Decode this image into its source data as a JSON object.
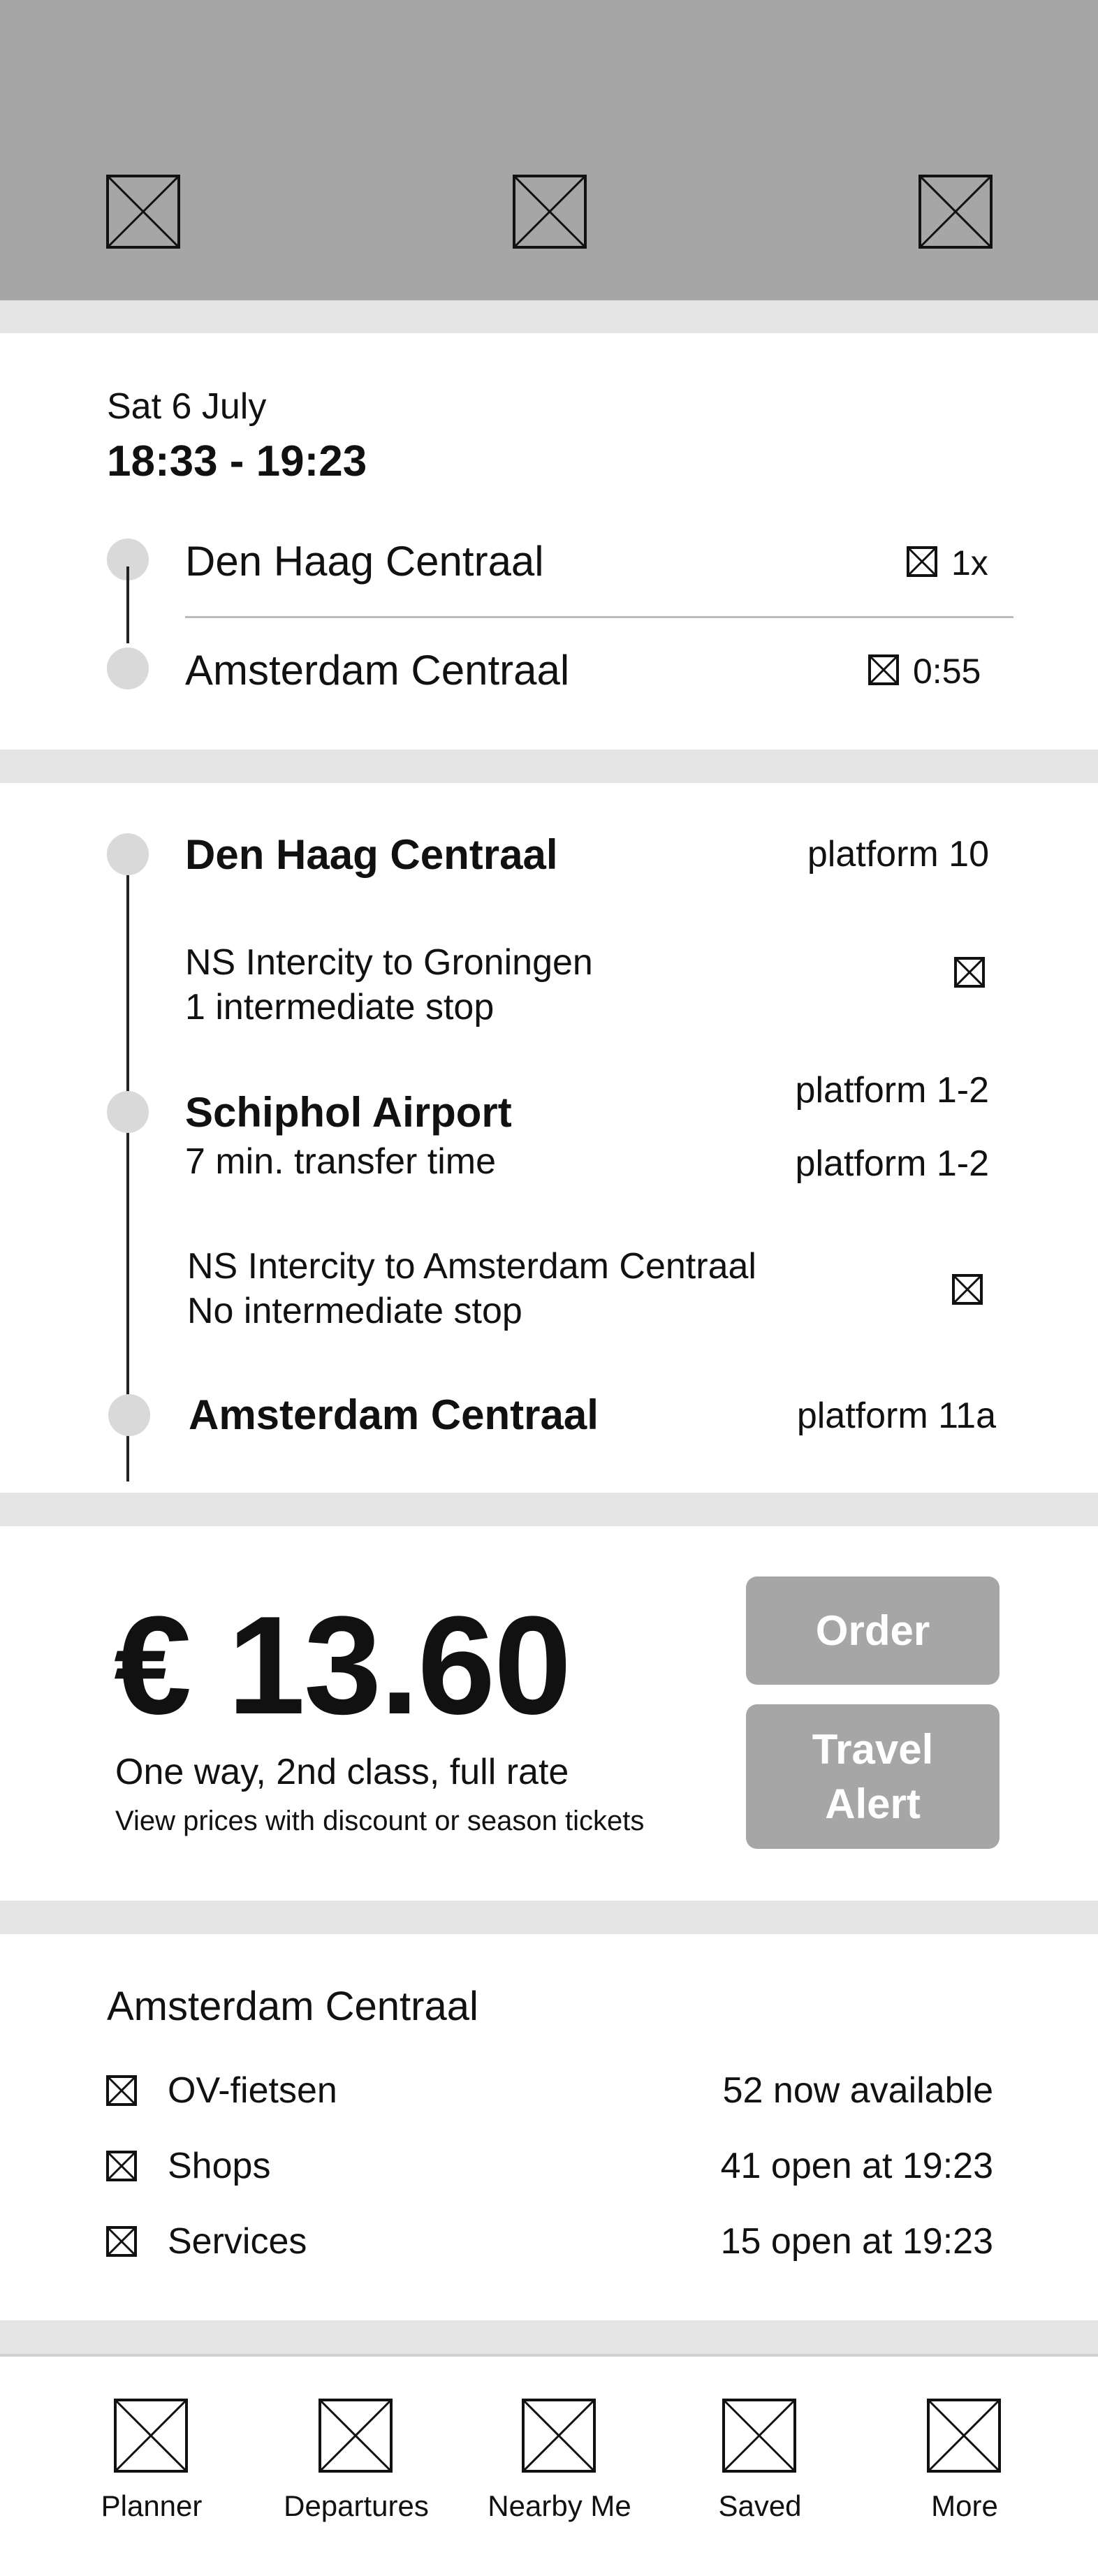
{
  "header": {
    "icons": [
      "placeholder-icon",
      "placeholder-icon",
      "placeholder-icon"
    ]
  },
  "summary": {
    "date": "Sat 6 July",
    "time_range": "18:33 - 19:23",
    "from": "Den Haag Centraal",
    "to": "Amsterdam Centraal",
    "transfers": "1x",
    "duration": "0:55"
  },
  "route": {
    "stop1": {
      "name": "Den Haag Centraal",
      "platform": "platform 10"
    },
    "leg1": {
      "line1": "NS Intercity to Groningen",
      "line2": "1 intermediate stop"
    },
    "stop2": {
      "name": "Schiphol Airport",
      "sub": "7 min. transfer time",
      "platform_arr": "platform 1-2",
      "platform_dep": "platform 1-2"
    },
    "leg2": {
      "line1": "NS Intercity to Amsterdam Centraal",
      "line2": "No intermediate stop"
    },
    "stop3": {
      "name": "Amsterdam Centraal",
      "platform": "platform 11a"
    }
  },
  "price": {
    "amount": "€ 13.60",
    "fare": "One way, 2nd class, full rate",
    "discount_link": "View prices with discount or season tickets",
    "order_label": "Order",
    "alert_line1": "Travel",
    "alert_line2": "Alert"
  },
  "station_info": {
    "title": "Amsterdam Centraal",
    "rows": [
      {
        "label": "OV-fietsen",
        "value": "52 now available"
      },
      {
        "label": "Shops",
        "value": "41 open at 19:23"
      },
      {
        "label": "Services",
        "value": "15 open at 19:23"
      }
    ]
  },
  "bottom_nav": {
    "items": [
      {
        "label": "Planner"
      },
      {
        "label": "Departures"
      },
      {
        "label": "Nearby Me"
      },
      {
        "label": "Saved"
      },
      {
        "label": "More"
      }
    ]
  }
}
